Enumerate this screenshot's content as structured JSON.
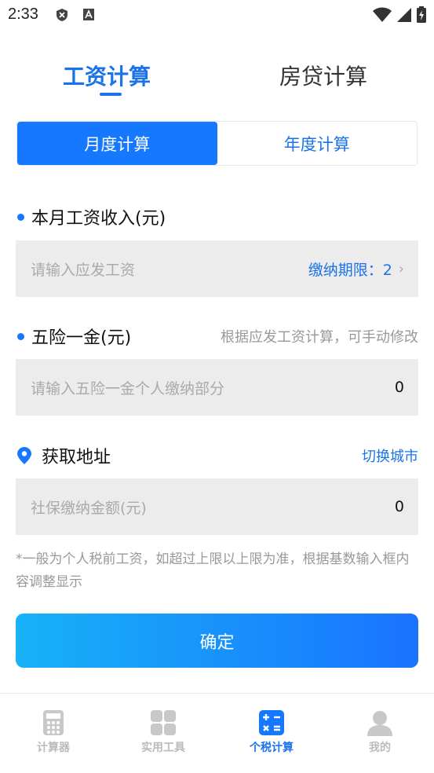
{
  "status_bar": {
    "time": "2:33"
  },
  "top_tabs": {
    "salary": "工资计算",
    "mortgage": "房贷计算"
  },
  "segment": {
    "monthly": "月度计算",
    "yearly": "年度计算"
  },
  "income": {
    "label": "本月工资收入(元)",
    "placeholder": "请输入应发工资",
    "period_label": "缴纳期限：2"
  },
  "insurance": {
    "label": "五险一金(元)",
    "hint": "根据应发工资计算，可手动修改",
    "placeholder": "请输入五险一金个人缴纳部分",
    "value": "0"
  },
  "location": {
    "label": "获取地址",
    "switch_city": "切换城市",
    "placeholder": "社保缴纳金额(元)",
    "value": "0"
  },
  "note": "*一般为个人税前工资，如超过上限以上限为准，根据基数输入框内容调整显示",
  "confirm_label": "确定",
  "bottom_nav": {
    "items": [
      {
        "label": "计算器"
      },
      {
        "label": "实用工具"
      },
      {
        "label": "个税计算"
      },
      {
        "label": "我的"
      }
    ]
  },
  "colors": {
    "accent": "#1677ff",
    "inactive": "#bbbbbb",
    "input_bg": "#ececec"
  }
}
